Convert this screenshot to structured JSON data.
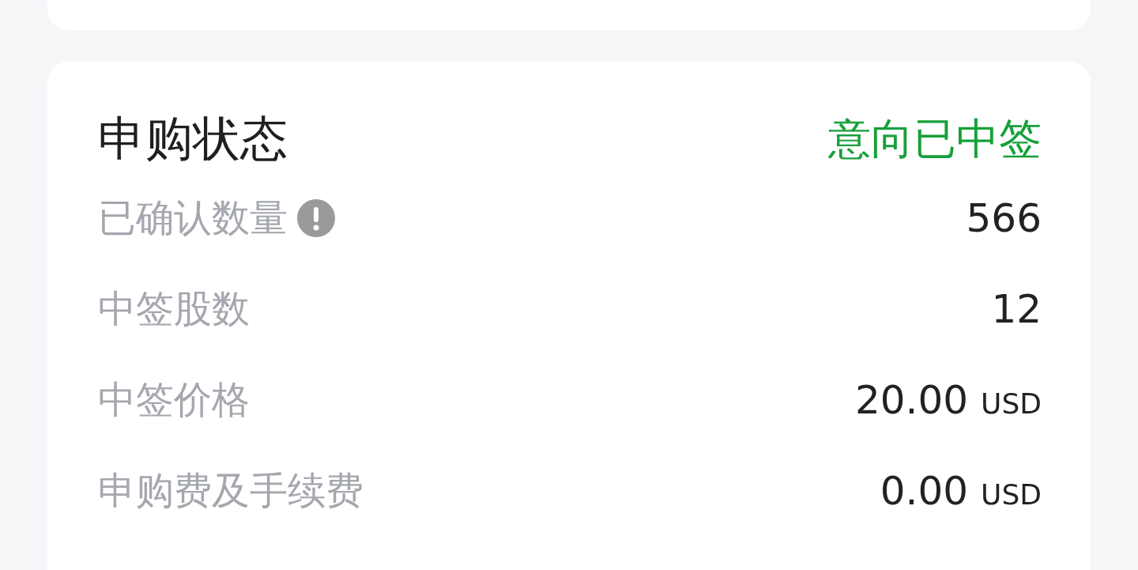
{
  "section": {
    "title": "申购状态",
    "status": "意向已中签"
  },
  "rows": [
    {
      "label": "已确认数量",
      "info": true,
      "value": "566"
    },
    {
      "label": "中签股数",
      "info": false,
      "value": "12"
    },
    {
      "label": "中签价格",
      "info": false,
      "value": "20.00",
      "unit": "USD"
    },
    {
      "label": "申购费及手续费",
      "info": false,
      "value": "0.00",
      "unit": "USD"
    }
  ]
}
